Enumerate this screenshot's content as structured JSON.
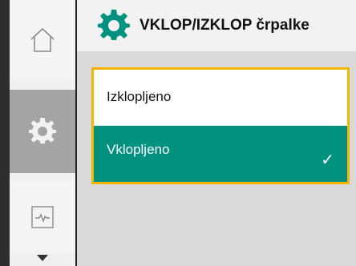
{
  "header": {
    "title": "VKLOP/IZKLOP črpalke",
    "icon": "gear-icon",
    "icon_color": "#00917f"
  },
  "sidebar": {
    "items": [
      {
        "name": "home",
        "icon": "home-icon"
      },
      {
        "name": "settings",
        "icon": "gear-icon",
        "selected": true
      },
      {
        "name": "trend",
        "icon": "trend-icon"
      }
    ],
    "scroll_indicator": "chevron-down-icon"
  },
  "menu": {
    "border_color": "#f5b400",
    "options": [
      {
        "label": "Izklopljeno",
        "selected": false
      },
      {
        "label": "Vklopljeno",
        "selected": true,
        "check": "✓"
      }
    ],
    "selected_color": "#00917f"
  }
}
